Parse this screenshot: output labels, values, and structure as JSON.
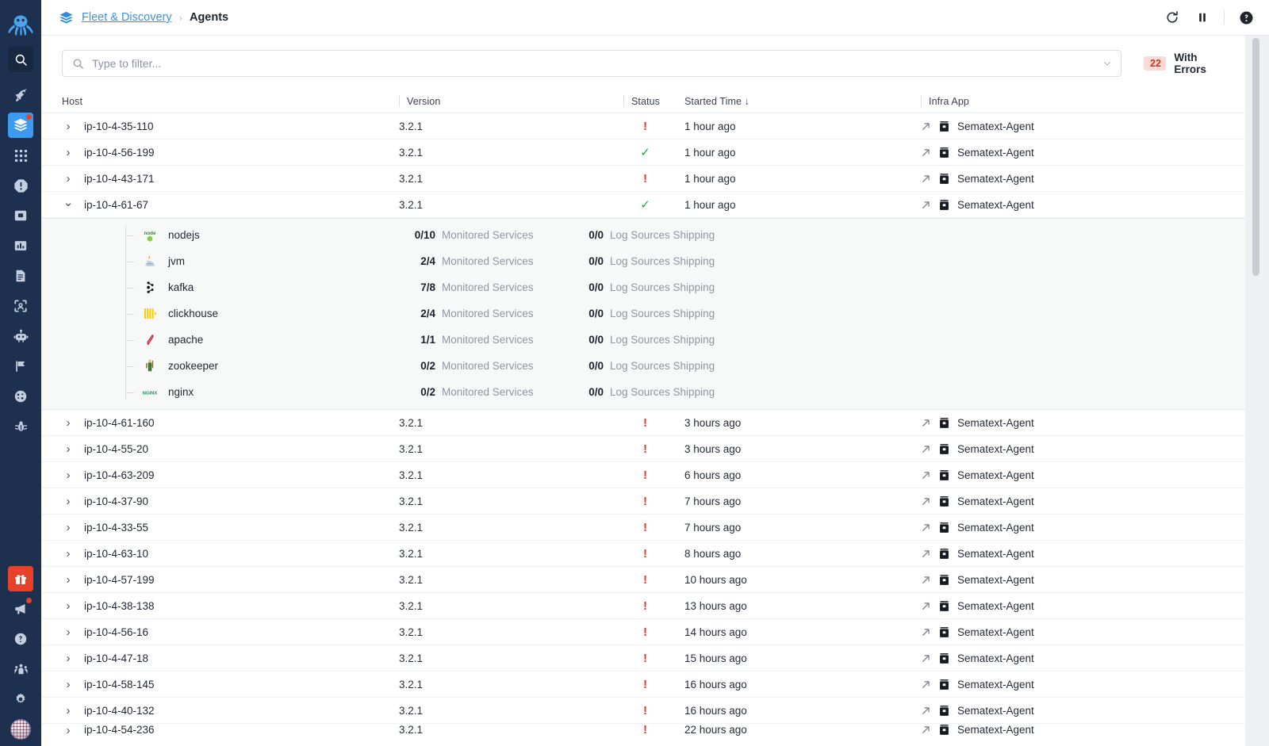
{
  "sidebar": {
    "logo_icon": "octopus-logo",
    "top_items": [
      {
        "name": "search",
        "icon": "search-icon",
        "active": false,
        "boxed": true
      },
      {
        "name": "rocket",
        "icon": "rocket-icon",
        "active": false
      },
      {
        "name": "fleet-discovery",
        "icon": "fleet-icon",
        "active": true,
        "badge": true
      },
      {
        "name": "apps-grid",
        "icon": "grid-icon",
        "active": false
      },
      {
        "name": "alerts",
        "icon": "alert-octagon-icon",
        "active": false
      },
      {
        "name": "inbox",
        "icon": "inbox-icon",
        "active": false
      },
      {
        "name": "reports",
        "icon": "bar-chart-icon",
        "active": false
      },
      {
        "name": "logs",
        "icon": "document-icon",
        "active": false
      },
      {
        "name": "synthetics",
        "icon": "scan-frame-icon",
        "active": false
      },
      {
        "name": "bots",
        "icon": "robot-icon",
        "active": false
      },
      {
        "name": "flags",
        "icon": "flag-icon",
        "active": false
      },
      {
        "name": "experience",
        "icon": "dashboard-gauge-icon",
        "active": false
      },
      {
        "name": "errors",
        "icon": "bug-icon",
        "active": false
      }
    ],
    "bottom_items": [
      {
        "name": "gift",
        "icon": "gift-icon",
        "highlight": true
      },
      {
        "name": "announcements",
        "icon": "megaphone-icon",
        "badge": true
      },
      {
        "name": "help",
        "icon": "help-circle-icon"
      },
      {
        "name": "team",
        "icon": "users-icon"
      },
      {
        "name": "settings",
        "icon": "gear-icon"
      },
      {
        "name": "account-avatar",
        "icon": "avatar-icon"
      }
    ]
  },
  "header": {
    "product_icon": "fleet-icon",
    "breadcrumb_parent": "Fleet & Discovery",
    "breadcrumb_separator": "›",
    "breadcrumb_current": "Agents",
    "actions": [
      {
        "name": "refresh-button",
        "icon": "refresh-icon"
      },
      {
        "name": "pause-button",
        "icon": "pause-icon"
      },
      {
        "name": "help-button",
        "icon": "help-filled-icon"
      }
    ]
  },
  "filter": {
    "placeholder": "Type to filter...",
    "value": "",
    "search_icon": "search-icon",
    "caret_icon": "chevron-down-icon",
    "errors_count": "22",
    "errors_label": "With Errors",
    "errors_badge_bg": "#fbdad5",
    "errors_badge_fg": "#bf3a25"
  },
  "table": {
    "columns": [
      {
        "key": "host",
        "label": "Host"
      },
      {
        "key": "version",
        "label": "Version"
      },
      {
        "key": "status",
        "label": "Status"
      },
      {
        "key": "started_time",
        "label": "Started Time ↓"
      },
      {
        "key": "infra_app",
        "label": "Infra App"
      }
    ],
    "status_ok_glyph": "✓",
    "status_error_glyph": "!",
    "infra_ext_icon": "external-link-icon",
    "infra_box_icon": "archive-box-icon",
    "chevron_collapsed": "›",
    "chevron_expanded": "⌄",
    "rows": [
      {
        "host": "ip-10-4-35-110",
        "version": "3.2.1",
        "status": "error",
        "time": "1 hour ago",
        "infra_app": "Sematext-Agent",
        "expanded": false
      },
      {
        "host": "ip-10-4-56-199",
        "version": "3.2.1",
        "status": "ok",
        "time": "1 hour ago",
        "infra_app": "Sematext-Agent",
        "expanded": false
      },
      {
        "host": "ip-10-4-43-171",
        "version": "3.2.1",
        "status": "error",
        "time": "1 hour ago",
        "infra_app": "Sematext-Agent",
        "expanded": false
      },
      {
        "host": "ip-10-4-61-67",
        "version": "3.2.1",
        "status": "ok",
        "time": "1 hour ago",
        "infra_app": "Sematext-Agent",
        "expanded": true
      },
      {
        "host": "ip-10-4-61-160",
        "version": "3.2.1",
        "status": "error",
        "time": "3 hours ago",
        "infra_app": "Sematext-Agent",
        "expanded": false
      },
      {
        "host": "ip-10-4-55-20",
        "version": "3.2.1",
        "status": "error",
        "time": "3 hours ago",
        "infra_app": "Sematext-Agent",
        "expanded": false
      },
      {
        "host": "ip-10-4-63-209",
        "version": "3.2.1",
        "status": "error",
        "time": "6 hours ago",
        "infra_app": "Sematext-Agent",
        "expanded": false
      },
      {
        "host": "ip-10-4-37-90",
        "version": "3.2.1",
        "status": "error",
        "time": "7 hours ago",
        "infra_app": "Sematext-Agent",
        "expanded": false
      },
      {
        "host": "ip-10-4-33-55",
        "version": "3.2.1",
        "status": "error",
        "time": "7 hours ago",
        "infra_app": "Sematext-Agent",
        "expanded": false
      },
      {
        "host": "ip-10-4-63-10",
        "version": "3.2.1",
        "status": "error",
        "time": "8 hours ago",
        "infra_app": "Sematext-Agent",
        "expanded": false
      },
      {
        "host": "ip-10-4-57-199",
        "version": "3.2.1",
        "status": "error",
        "time": "10 hours ago",
        "infra_app": "Sematext-Agent",
        "expanded": false
      },
      {
        "host": "ip-10-4-38-138",
        "version": "3.2.1",
        "status": "error",
        "time": "13 hours ago",
        "infra_app": "Sematext-Agent",
        "expanded": false
      },
      {
        "host": "ip-10-4-56-16",
        "version": "3.2.1",
        "status": "error",
        "time": "14 hours ago",
        "infra_app": "Sematext-Agent",
        "expanded": false
      },
      {
        "host": "ip-10-4-47-18",
        "version": "3.2.1",
        "status": "error",
        "time": "15 hours ago",
        "infra_app": "Sematext-Agent",
        "expanded": false
      },
      {
        "host": "ip-10-4-58-145",
        "version": "3.2.1",
        "status": "error",
        "time": "16 hours ago",
        "infra_app": "Sematext-Agent",
        "expanded": false
      },
      {
        "host": "ip-10-4-40-132",
        "version": "3.2.1",
        "status": "error",
        "time": "16 hours ago",
        "infra_app": "Sematext-Agent",
        "expanded": false
      },
      {
        "host": "ip-10-4-54-236",
        "version": "3.2.1",
        "status": "error",
        "time": "22 hours ago",
        "infra_app": "Sematext-Agent",
        "expanded": false,
        "partial": true
      }
    ],
    "expanded_services": [
      {
        "name": "nodejs",
        "icon": "nodejs-icon",
        "monitored": "0/10",
        "monitored_label": "Monitored Services",
        "logs": "0/0",
        "logs_label": "Log Sources Shipping"
      },
      {
        "name": "jvm",
        "icon": "java-icon",
        "monitored": "2/4",
        "monitored_label": "Monitored Services",
        "logs": "0/0",
        "logs_label": "Log Sources Shipping"
      },
      {
        "name": "kafka",
        "icon": "kafka-icon",
        "monitored": "7/8",
        "monitored_label": "Monitored Services",
        "logs": "0/0",
        "logs_label": "Log Sources Shipping"
      },
      {
        "name": "clickhouse",
        "icon": "clickhouse-icon",
        "monitored": "2/4",
        "monitored_label": "Monitored Services",
        "logs": "0/0",
        "logs_label": "Log Sources Shipping"
      },
      {
        "name": "apache",
        "icon": "apache-icon",
        "monitored": "1/1",
        "monitored_label": "Monitored Services",
        "logs": "0/0",
        "logs_label": "Log Sources Shipping"
      },
      {
        "name": "zookeeper",
        "icon": "zookeeper-icon",
        "monitored": "0/2",
        "monitored_label": "Monitored Services",
        "logs": "0/0",
        "logs_label": "Log Sources Shipping"
      },
      {
        "name": "nginx",
        "icon": "nginx-icon",
        "monitored": "0/2",
        "monitored_label": "Monitored Services",
        "logs": "0/0",
        "logs_label": "Log Sources Shipping"
      }
    ]
  },
  "colors": {
    "sidebar_bg": "#1e3050",
    "accent_blue": "#3c9bf0",
    "link_blue": "#3f8fe0",
    "error_red": "#e8352a",
    "ok_green": "#2f9e49",
    "expanded_bg": "#f7f9f8"
  }
}
